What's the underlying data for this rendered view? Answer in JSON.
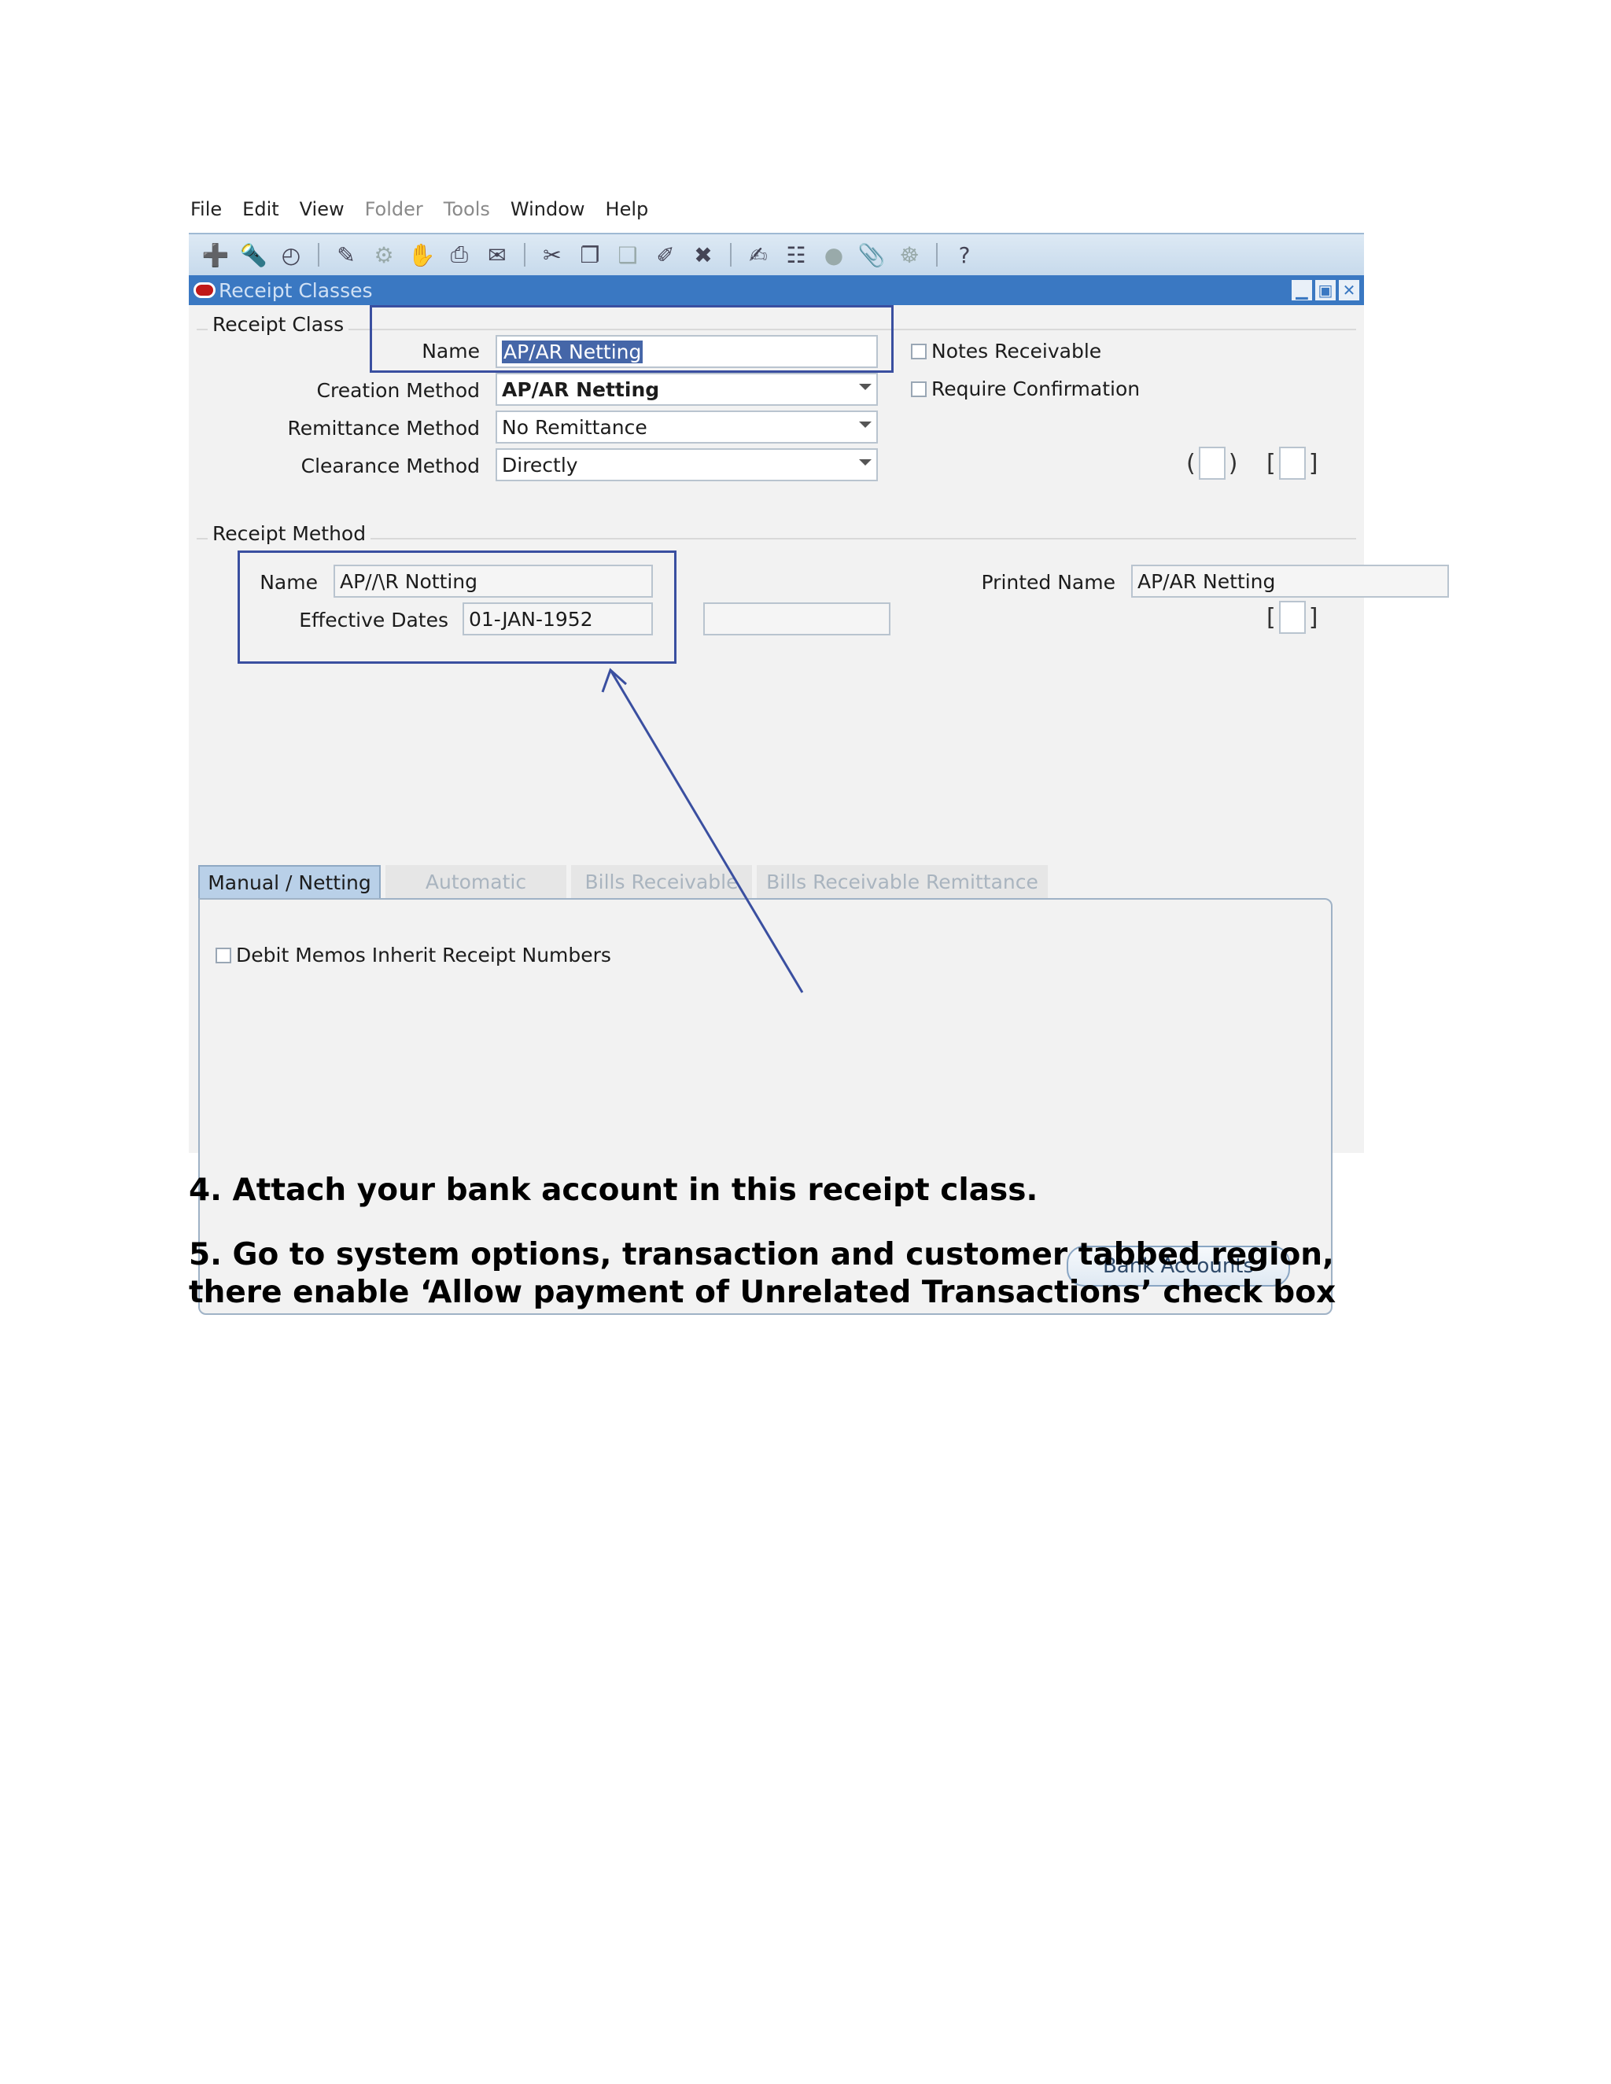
{
  "menu": [
    "File",
    "Edit",
    "View",
    "Folder",
    "Tools",
    "Window",
    "Help"
  ],
  "toolbar": {
    "help_glyph": "?"
  },
  "window": {
    "title": "Receipt Classes"
  },
  "receipt_class": {
    "section_label": "Receipt Class",
    "name_label": "Name",
    "name_value": "AP/AR Netting",
    "creation_method_label": "Creation Method",
    "creation_method_value": "AP/AR Netting",
    "remittance_method_label": "Remittance Method",
    "remittance_method_value": "No Remittance",
    "clearance_method_label": "Clearance Method",
    "clearance_method_value": "Directly",
    "notes_receivable_label": "Notes Receivable",
    "require_confirmation_label": "Require Confirmation"
  },
  "receipt_method": {
    "section_label": "Receipt Method",
    "name_label": "Name",
    "name_value": "AP//\\R Notting",
    "effective_dates_label": "Effective Dates",
    "effective_dates_value": "01-JAN-1952",
    "printed_name_label": "Printed Name",
    "printed_name_value": "AP/AR Netting"
  },
  "tabs": [
    {
      "label": "Manual / Netting",
      "active": true
    },
    {
      "label": "Automatic",
      "active": false
    },
    {
      "label": "Bills Receivable",
      "active": false
    },
    {
      "label": "Bills Receivable Remittance",
      "active": false
    }
  ],
  "tab_panel": {
    "debit_memos_label": "Debit Memos Inherit Receipt Numbers",
    "bank_accounts_button": "Bank Accounts"
  },
  "instructions": {
    "step4": "4. Attach your bank account in this receipt class.",
    "step5": "5. Go to system options, transaction and customer tabbed region, there enable ‘Allow payment of Unrelated Transactions’ check box"
  },
  "colors": {
    "title_bar": "#3a78c2",
    "annotation": "#3a4fa0",
    "toolbar": "#c7daec"
  }
}
